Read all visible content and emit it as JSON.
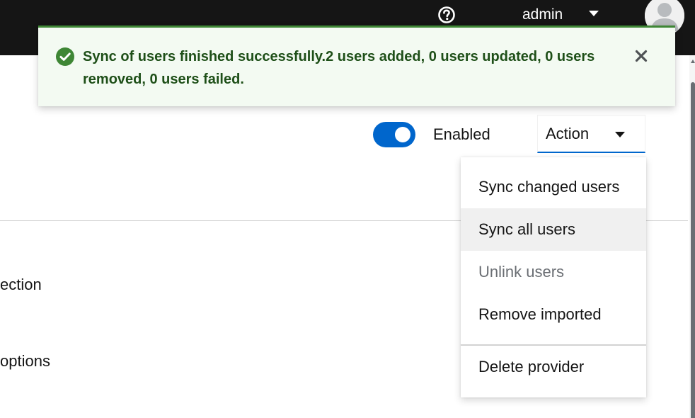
{
  "masthead": {
    "help_icon": "question-circle-icon",
    "user_name": "admin",
    "caret_icon": "caret-down-icon",
    "avatar_icon": "user-avatar-icon",
    "background": "#151515"
  },
  "alert": {
    "status": "success",
    "icon": "check-circle-icon",
    "message": "Sync of users finished successfully.2 users added, 0 users updated, 0 users removed, 0 users failed.",
    "close_icon": "close-icon",
    "color": "#3e8635"
  },
  "toolbar": {
    "enabled_on": true,
    "enabled_label": "Enabled",
    "action_label": "Action"
  },
  "action_menu": {
    "items": [
      {
        "label": "Sync changed users",
        "state": "normal"
      },
      {
        "label": "Sync all users",
        "state": "hover"
      },
      {
        "label": "Unlink users",
        "state": "disabled"
      },
      {
        "label": "Remove imported",
        "state": "normal"
      },
      {
        "label": "Delete provider",
        "state": "normal"
      }
    ]
  },
  "side": {
    "label_1": "ection",
    "label_2": "options"
  },
  "accent": "#0066cc"
}
